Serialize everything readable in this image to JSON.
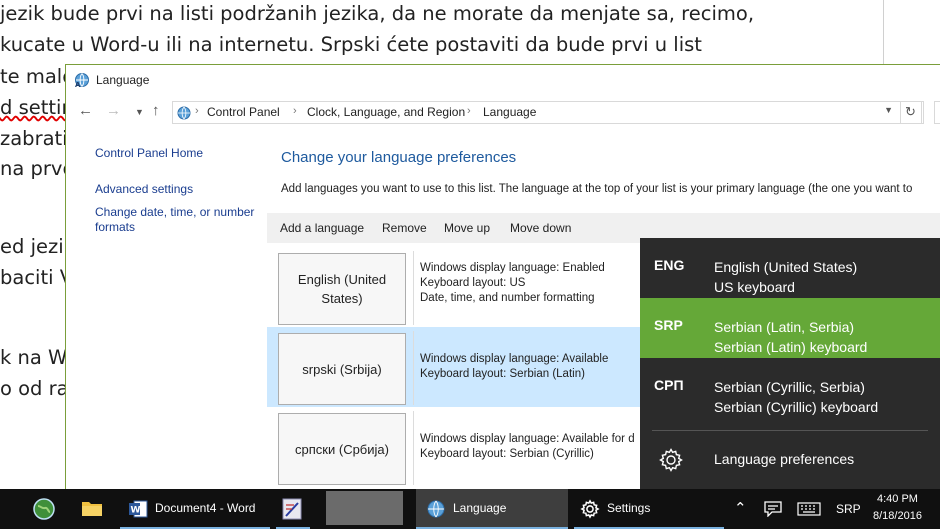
{
  "document": {
    "lines": [
      "jezik bude prvi na listi podržanih jezika, da ne morate da menjate sa, recimo,",
      "kucate u Word-u ili na internetu. Srpski ćete postaviti da bude prvi u list",
      "te malo",
      "d settin",
      "zabrati",
      "na prvo",
      "ed jezik",
      "baciti V",
      "k na Wi",
      "o od ran"
    ]
  },
  "window": {
    "title": "Language",
    "breadcrumbs": [
      "Control Panel",
      "Clock, Language, and Region",
      "Language"
    ],
    "side_links": [
      "Control Panel Home",
      "Advanced settings",
      "Change date, time, or number formats"
    ],
    "heading": "Change your language preferences",
    "description": "Add languages you want to use to this list. The language at the top of your list is your primary language (the one you want to",
    "toolbar": {
      "add": "Add a language",
      "remove": "Remove",
      "move_up": "Move up",
      "move_down": "Move down"
    },
    "languages": [
      {
        "name": "English (United States)",
        "info": [
          "Windows display language: Enabled",
          "Keyboard layout: US",
          "Date, time, and number formatting"
        ]
      },
      {
        "name": "srpski (Srbija)",
        "info": [
          "Windows display language: Available",
          "Keyboard layout: Serbian (Latin)"
        ]
      },
      {
        "name": "српски (Србија)",
        "info": [
          "Windows display language: Available for d",
          "Keyboard layout: Serbian (Cyrillic)"
        ]
      }
    ]
  },
  "flyout": {
    "items": [
      {
        "code": "ENG",
        "line1": "English (United States)",
        "line2": "US keyboard"
      },
      {
        "code": "SRP",
        "line1": "Serbian (Latin, Serbia)",
        "line2": "Serbian (Latin) keyboard"
      },
      {
        "code": "СРП",
        "line1": "Serbian (Cyrillic, Serbia)",
        "line2": "Serbian (Cyrillic) keyboard"
      }
    ],
    "preferences_label": "Language preferences",
    "active_color": "#65a838"
  },
  "taskbar": {
    "apps": [
      {
        "label": "Document4 - Word",
        "icon": "word-icon"
      },
      {
        "label": "Language",
        "icon": "language-icon"
      },
      {
        "label": "Settings",
        "icon": "settings-gear-icon"
      }
    ],
    "input_indicator": "SRP",
    "time": "4:40 PM",
    "date": "8/18/2016"
  }
}
